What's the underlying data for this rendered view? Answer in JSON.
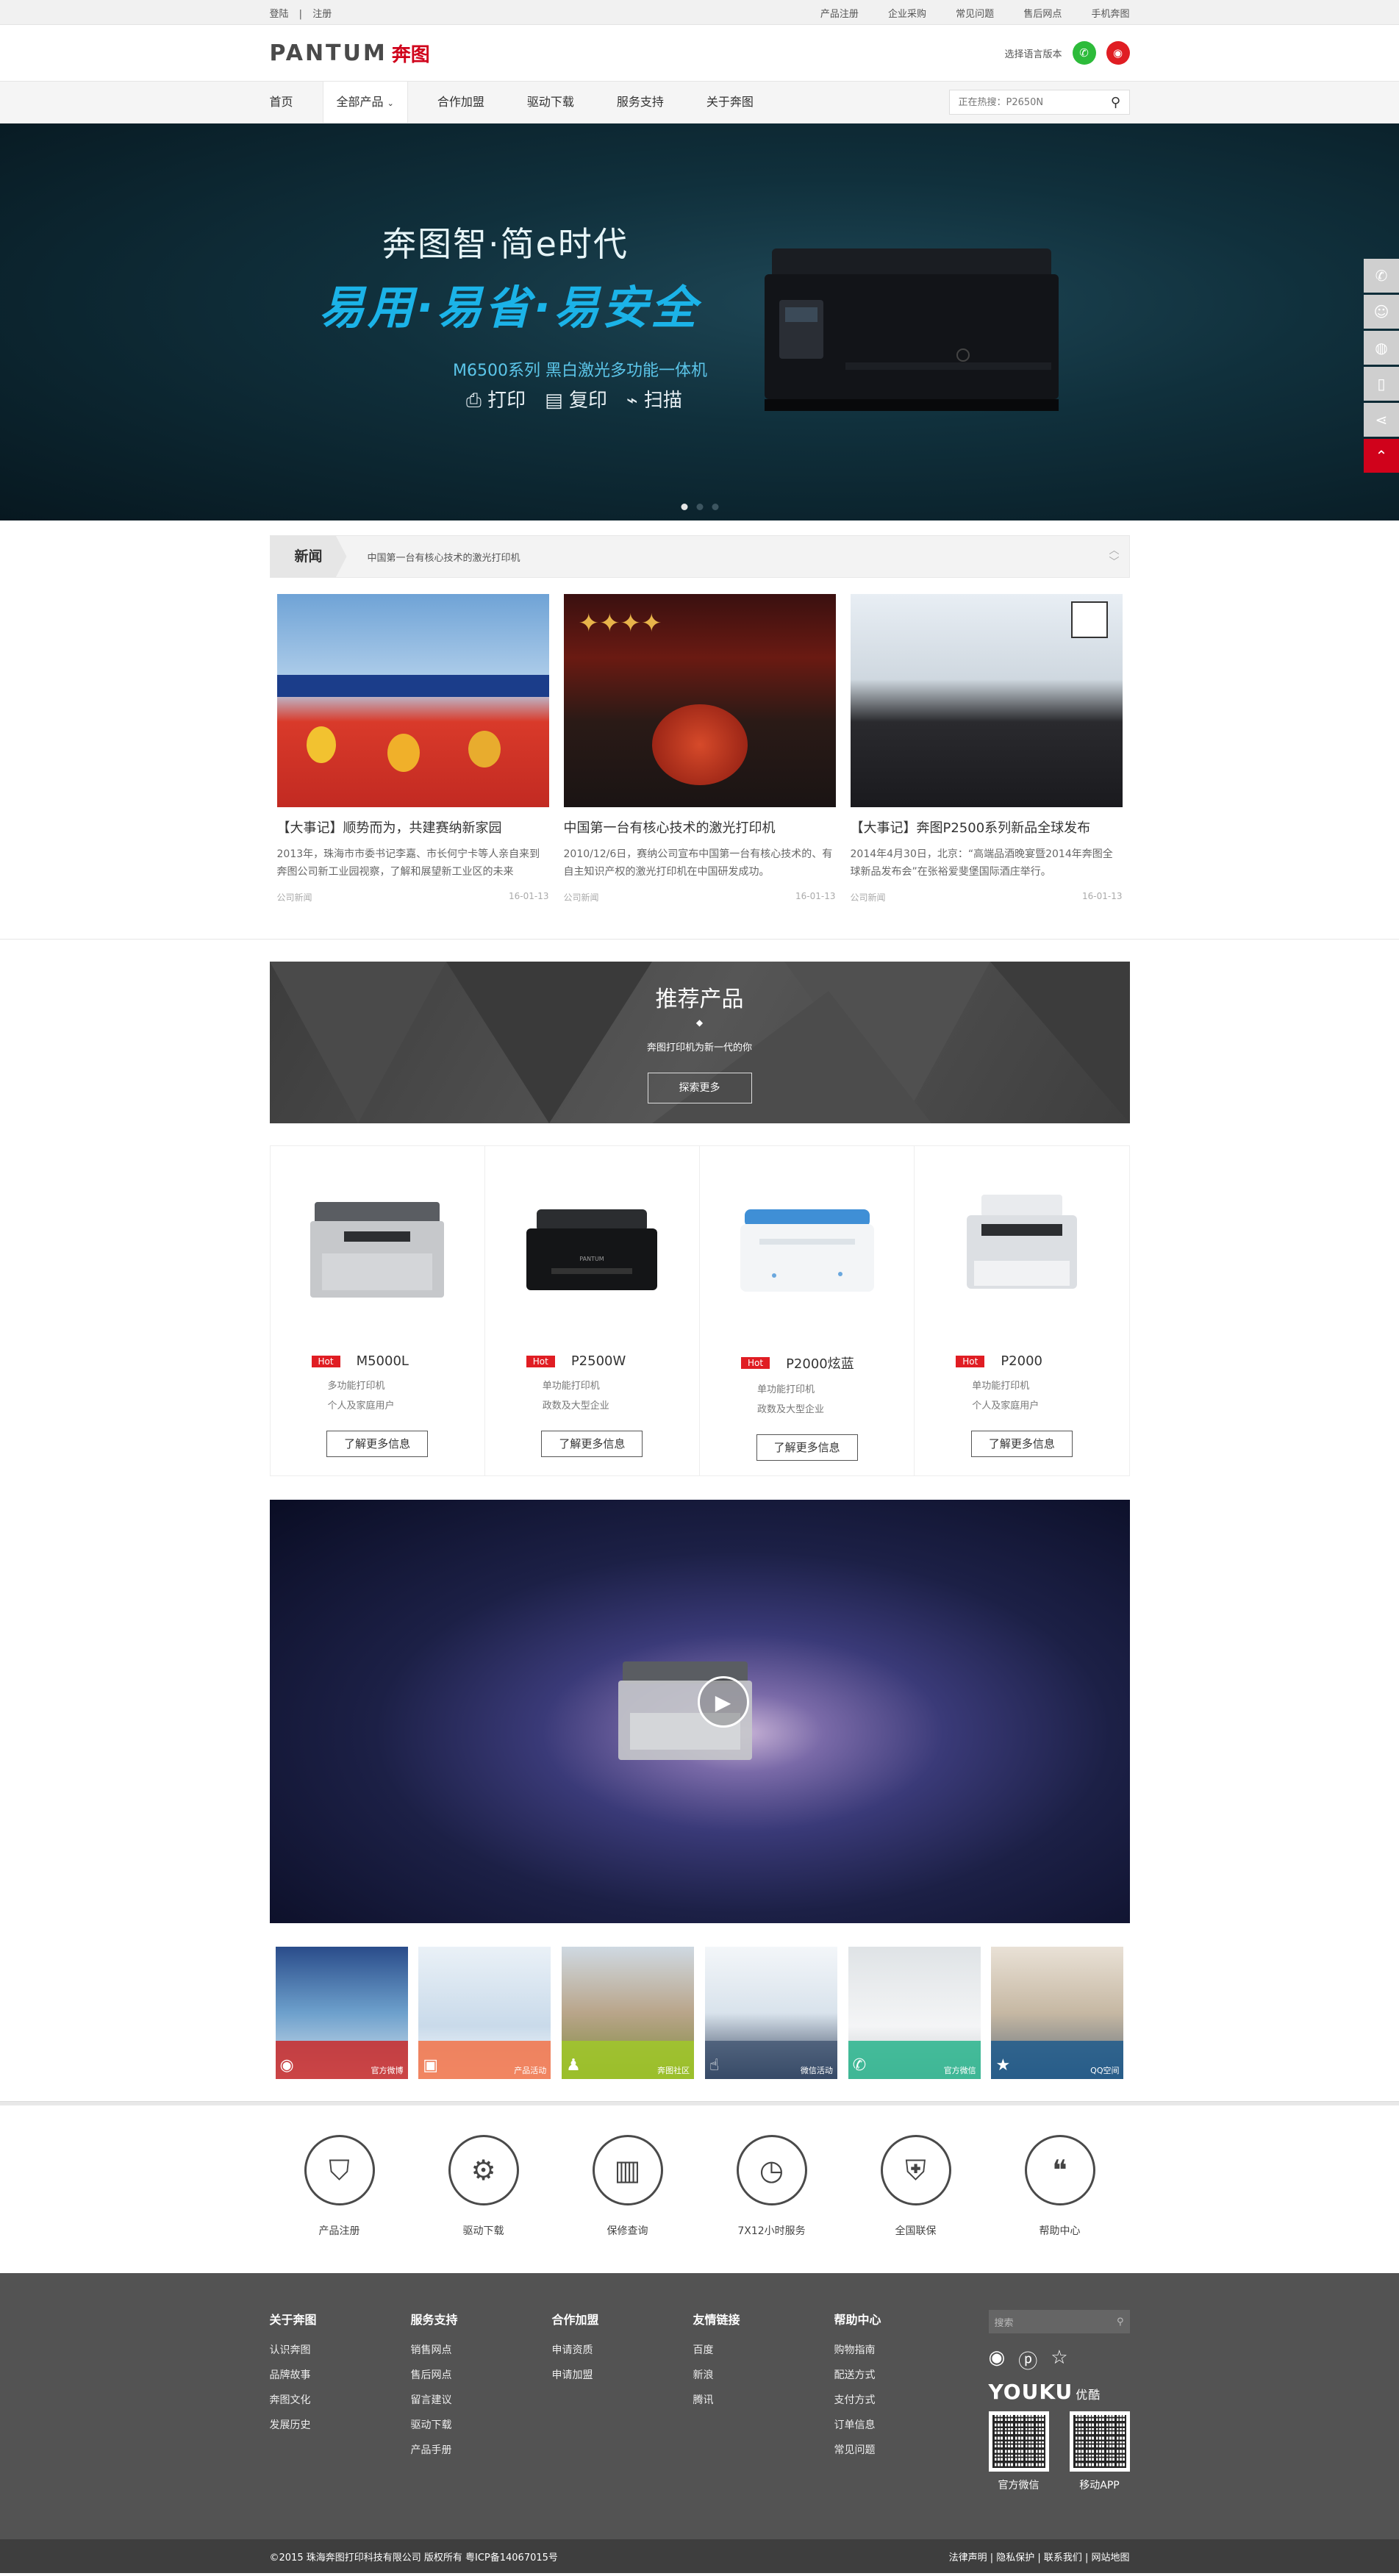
{
  "topbar": {
    "login": "登陆",
    "sep": "|",
    "register": "注册",
    "links": [
      "产品注册",
      "企业采购",
      "常见问题",
      "售后网点",
      "手机奔图"
    ]
  },
  "header": {
    "logo_en": "PANTUM",
    "logo_cn": "奔图",
    "language": "选择语言版本"
  },
  "nav": {
    "items": [
      "首页",
      "全部产品",
      "合作加盟",
      "驱动下载",
      "服务支持",
      "关于奔图"
    ],
    "search_placeholder": "正在热搜：P2650N"
  },
  "banner": {
    "title": "奔图智·简e时代",
    "big": "易用·易省·易安全",
    "sub": "M6500系列 黑白激光多功能一体机",
    "features": [
      "打印",
      "复印",
      "扫描"
    ]
  },
  "news": {
    "tag": "新闻",
    "ticker": "中国第一台有核心技术的激光打印机",
    "items": [
      {
        "title": "【大事记】顺势而为，共建赛纳新家园",
        "desc": "2013年，珠海市市委书记李嘉、市长何宁卡等人亲自来到奔图公司新工业园视察，了解和展望新工业区的未来",
        "cat": "公司新闻",
        "date": "16-01-13"
      },
      {
        "title": "中国第一台有核心技术的激光打印机",
        "desc": "2010/12/6日，赛纳公司宣布中国第一台有核心技术的、有自主知识产权的激光打印机在中国研发成功。",
        "cat": "公司新闻",
        "date": "16-01-13"
      },
      {
        "title": "【大事记】奔图P2500系列新品全球发布",
        "desc": "2014年4月30日，北京：“高端品酒晚宴暨2014年奔图全球新品发布会”在张裕爱斐堡国际酒庄举行。",
        "cat": "公司新闻",
        "date": "16-01-13"
      }
    ]
  },
  "recommend": {
    "title": "推荐产品",
    "diamond": "◆",
    "subtitle": "奔图打印机为新一代的你",
    "button": "探索更多"
  },
  "products": [
    {
      "hot": "Hot",
      "name": "M5000L",
      "type": "多功能打印机",
      "user": "个人及家庭用户",
      "more": "了解更多信息"
    },
    {
      "hot": "Hot",
      "name": "P2500W",
      "type": "单功能打印机",
      "user": "政数及大型企业",
      "more": "了解更多信息"
    },
    {
      "hot": "Hot",
      "name": "P2000炫蓝",
      "type": "单功能打印机",
      "user": "政数及大型企业",
      "more": "了解更多信息"
    },
    {
      "hot": "Hot",
      "name": "P2000",
      "type": "单功能打印机",
      "user": "个人及家庭用户",
      "more": "了解更多信息"
    }
  ],
  "thumbs": [
    {
      "label": "官方微博",
      "icon": "weibo-icon"
    },
    {
      "label": "产品活动",
      "icon": "box-icon"
    },
    {
      "label": "奔图社区",
      "icon": "user-icon"
    },
    {
      "label": "微信活动",
      "icon": "hand-icon"
    },
    {
      "label": "官方微信",
      "icon": "wechat-icon"
    },
    {
      "label": "QQ空间",
      "icon": "star-icon"
    }
  ],
  "services": [
    "产品注册",
    "驱动下载",
    "保修查询",
    "7X12小时服务",
    "全国联保",
    "帮助中心"
  ],
  "footer": {
    "cols": [
      {
        "title": "关于奔图",
        "items": [
          "认识奔图",
          "品牌故事",
          "奔图文化",
          "发展历史"
        ]
      },
      {
        "title": "服务支持",
        "items": [
          "销售网点",
          "售后网点",
          "留言建议",
          "驱动下载",
          "产品手册"
        ]
      },
      {
        "title": "合作加盟",
        "items": [
          "申请资质",
          "申请加盟"
        ]
      },
      {
        "title": "友情链接",
        "items": [
          "百度",
          "新浪",
          "腾讯"
        ]
      },
      {
        "title": "帮助中心",
        "items": [
          "购物指南",
          "配送方式",
          "支付方式",
          "订单信息",
          "常见问题"
        ]
      }
    ],
    "search_placeholder": "搜索",
    "youku": "YOUKU",
    "youku_cn": "优酷",
    "qr1": "官方微信",
    "qr2": "移动APP"
  },
  "bottom": {
    "copyright": "©2015 珠海奔图打印科技有限公司 版权所有 粤ICP备14067015号",
    "links": "法律声明 | 隐私保护 | 联系我们 | 网站地图"
  }
}
